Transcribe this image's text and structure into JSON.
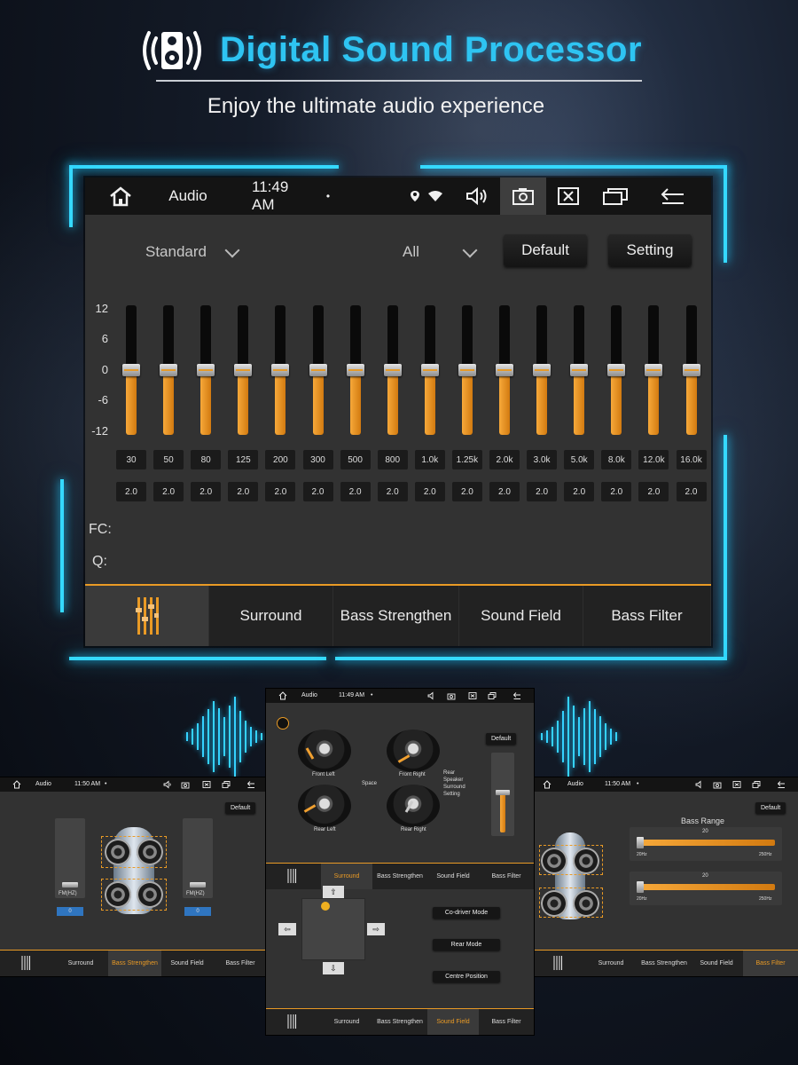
{
  "header": {
    "title": "Digital Sound Processor",
    "subtitle": "Enjoy the ultimate audio experience",
    "icon": "speaker-sound-icon"
  },
  "colors": {
    "accent": "#e99a25",
    "glow": "#35d9ff",
    "panel": "#323232",
    "statusbar": "#141414"
  },
  "main_screen": {
    "statusbar": {
      "app": "Audio",
      "time": "11:49 AM",
      "dot": "•"
    },
    "preset": {
      "label": "Standard"
    },
    "channel": {
      "label": "All"
    },
    "default_button": "Default",
    "setting_button": "Setting",
    "scale": [
      "12",
      "6",
      "0",
      "-6",
      "-12"
    ],
    "bands": [
      {
        "fc": "30",
        "q": "2.0",
        "gain": 0
      },
      {
        "fc": "50",
        "q": "2.0",
        "gain": 0
      },
      {
        "fc": "80",
        "q": "2.0",
        "gain": 0
      },
      {
        "fc": "125",
        "q": "2.0",
        "gain": 0
      },
      {
        "fc": "200",
        "q": "2.0",
        "gain": 0
      },
      {
        "fc": "300",
        "q": "2.0",
        "gain": 0
      },
      {
        "fc": "500",
        "q": "2.0",
        "gain": 0
      },
      {
        "fc": "800",
        "q": "2.0",
        "gain": 0
      },
      {
        "fc": "1.0k",
        "q": "2.0",
        "gain": 0
      },
      {
        "fc": "1.25k",
        "q": "2.0",
        "gain": 0
      },
      {
        "fc": "2.0k",
        "q": "2.0",
        "gain": 0
      },
      {
        "fc": "3.0k",
        "q": "2.0",
        "gain": 0
      },
      {
        "fc": "5.0k",
        "q": "2.0",
        "gain": 0
      },
      {
        "fc": "8.0k",
        "q": "2.0",
        "gain": 0
      },
      {
        "fc": "12.0k",
        "q": "2.0",
        "gain": 0
      },
      {
        "fc": "16.0k",
        "q": "2.0",
        "gain": 0
      }
    ],
    "fc_label": "FC:",
    "q_label": "Q:",
    "tabs": [
      "Surround",
      "Bass Strengthen",
      "Sound Field",
      "Bass Filter"
    ]
  },
  "left_screen": {
    "statusbar": {
      "app": "Audio",
      "time": "11:50 AM",
      "dot": "•"
    },
    "default_button": "Default",
    "left_slider": {
      "label": "FM(HZ)",
      "readout": "0"
    },
    "right_slider": {
      "label": "FM(HZ)",
      "readout": "0"
    },
    "tabs": [
      "Surround",
      "Bass Strengthen",
      "Sound Field",
      "Bass Filter"
    ],
    "active_tab": "Bass Strengthen"
  },
  "center_screen": {
    "statusbar": {
      "app": "Audio",
      "time": "11:49 AM",
      "dot": "•"
    },
    "default_button": "Default",
    "dials": {
      "front_left": "Front Left",
      "front_right": "Front Right",
      "rear_left": "Rear Left",
      "rear_right": "Rear Right",
      "space": "Space"
    },
    "rear_speaker_lines": [
      "Rear",
      "Speaker",
      "Surround",
      "Setting"
    ],
    "tabs_top": [
      "Surround",
      "Bass Strengthen",
      "Sound Field",
      "Bass Filter"
    ],
    "active_tab_top": "Surround",
    "modes": [
      "Co-driver Mode",
      "Rear Mode",
      "Centre Position"
    ],
    "tabs_bottom": [
      "Surround",
      "Bass Strengthen",
      "Sound Field",
      "Bass Filter"
    ],
    "active_tab_bottom": "Sound Field"
  },
  "right_screen": {
    "statusbar": {
      "app": "Audio",
      "time": "11:50 AM",
      "dot": "•"
    },
    "default_button": "Default",
    "title": "Bass Range",
    "range1": {
      "value": "20",
      "min": "20Hz",
      "max": "250Hz"
    },
    "range2": {
      "value": "20",
      "min": "20Hz",
      "max": "250Hz"
    },
    "tabs": [
      "Surround",
      "Bass Strengthen",
      "Sound Field",
      "Bass Filter"
    ],
    "active_tab": "Bass Filter"
  }
}
